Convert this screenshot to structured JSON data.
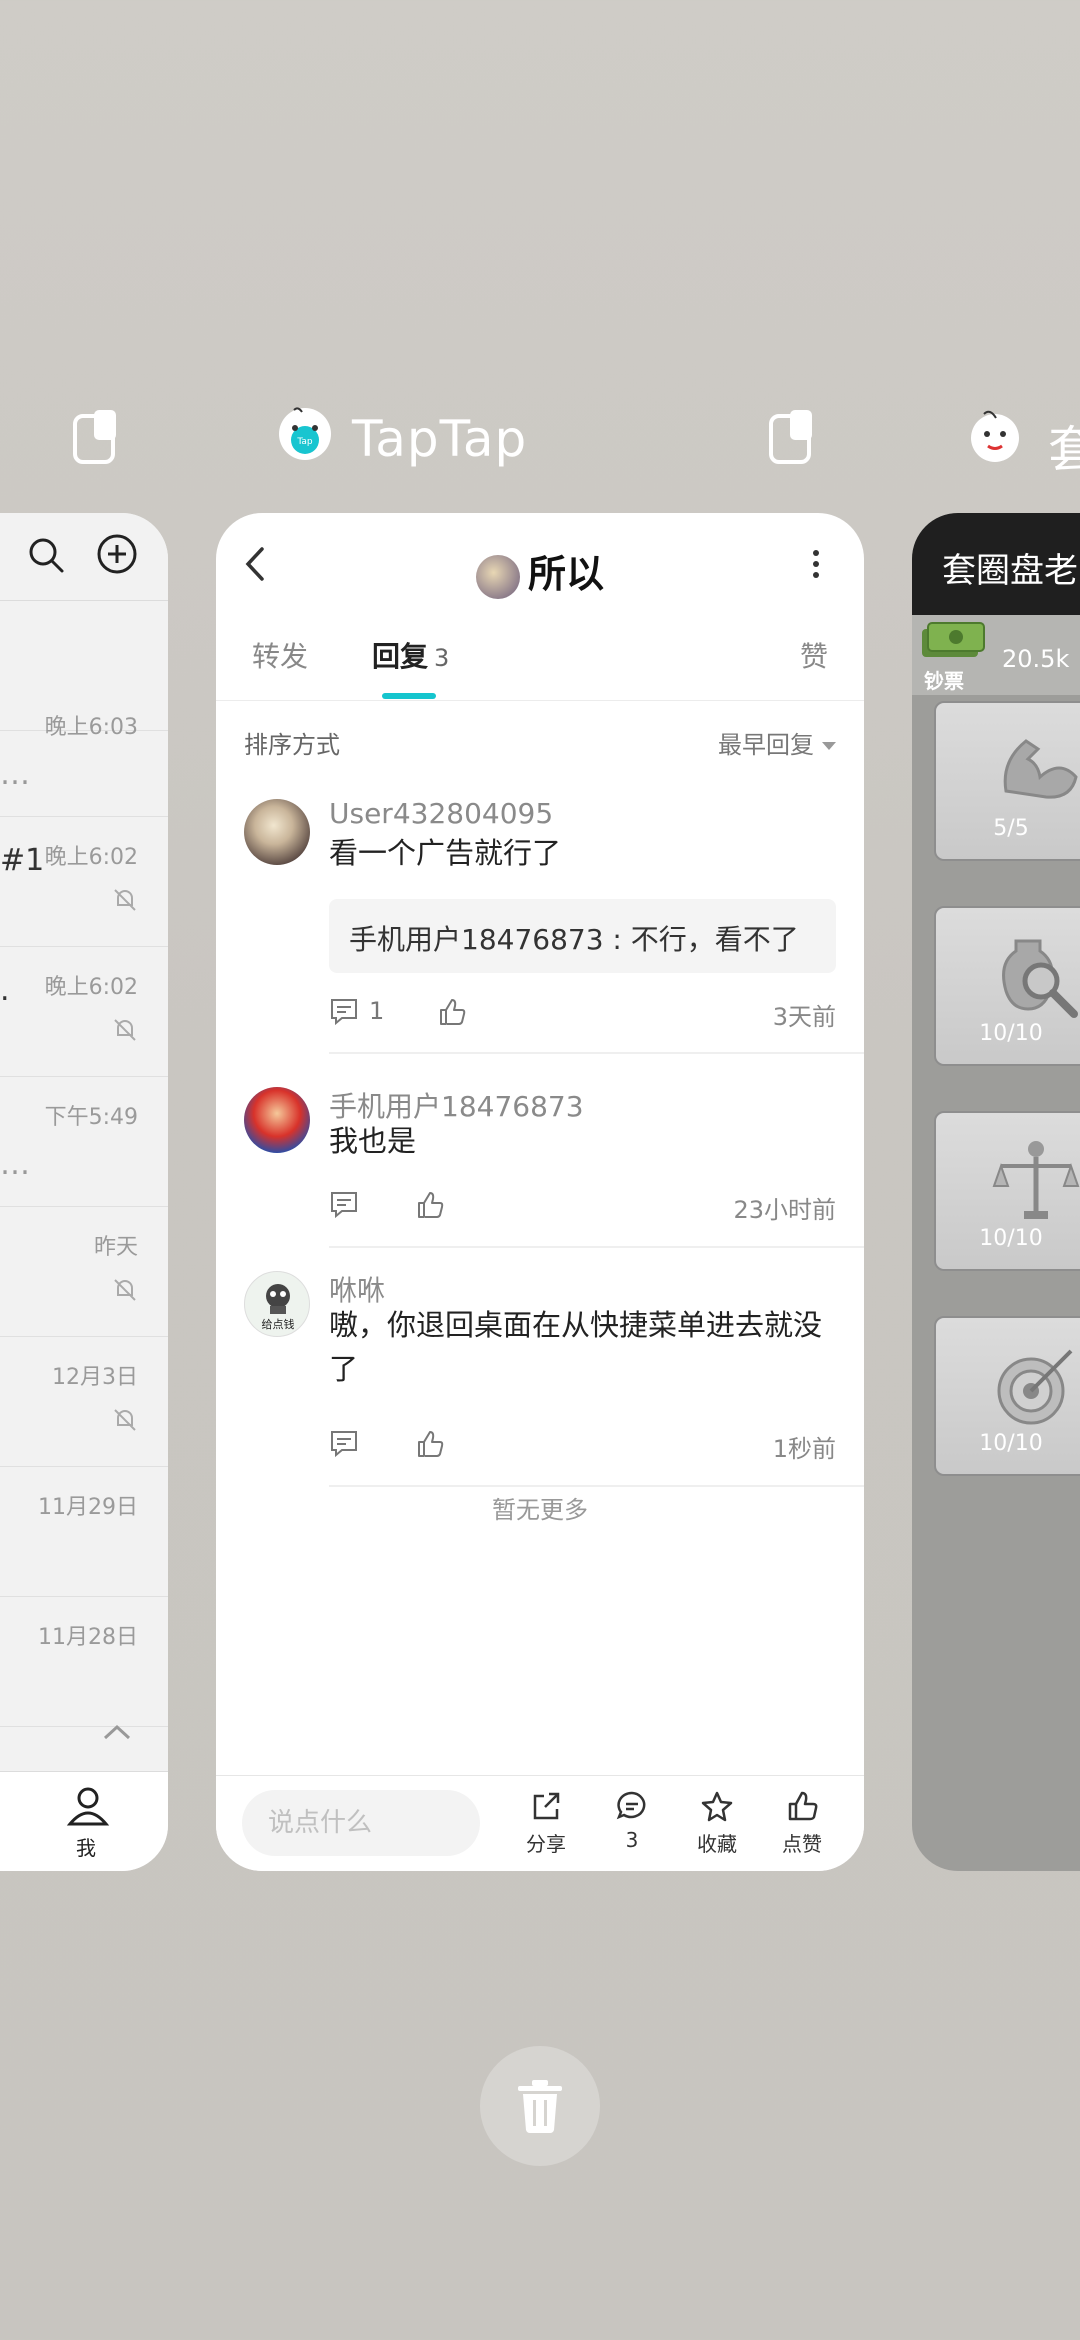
{
  "recents": {
    "center_app_name": "TapTap",
    "right_app_name_partial": "套"
  },
  "left_card": {
    "rows": [
      {
        "time": "晚上6:03",
        "fragment": "…",
        "muted": false
      },
      {
        "time": "晚上6:02",
        "fragment": "#1",
        "muted": true
      },
      {
        "time": "晚上6:02",
        "fragment": ".",
        "muted": true
      },
      {
        "time": "下午5:49",
        "fragment": "…",
        "muted": false
      },
      {
        "time": "昨天",
        "fragment": "",
        "muted": true
      },
      {
        "time": "12月3日",
        "fragment": "",
        "muted": true
      },
      {
        "time": "11月29日",
        "fragment": "",
        "muted": false
      },
      {
        "time": "11月28日",
        "fragment": "",
        "muted": false
      }
    ],
    "bottom_tab_label": "我"
  },
  "taptap": {
    "header_title": "所以",
    "tabs": [
      {
        "label": "转发"
      },
      {
        "label": "回复",
        "count": "3"
      },
      {
        "label": "赞"
      }
    ],
    "sort_label": "排序方式",
    "sort_value": "最早回复",
    "comments": [
      {
        "user": "User432804095",
        "text": "看一个广告就行了",
        "quote": "手机用户18476873 : 不行，看不了",
        "reply_count": "1",
        "time": "3天前"
      },
      {
        "user": "手机用户18476873",
        "text": "我也是",
        "time": "23小时前"
      },
      {
        "user": "咻咻",
        "text": "嗷，你退回桌面在从快捷菜单进去就没了",
        "time": "1秒前",
        "avatar_caption": "给点钱"
      }
    ],
    "no_more": "暂无更多",
    "footer": {
      "input_placeholder": "说点什么",
      "share_label": "分享",
      "comment_count": "3",
      "favorite_label": "收藏",
      "like_label": "点赞"
    },
    "accent_color": "#15c5ce"
  },
  "right_card": {
    "title": "套圈盘老",
    "cash_value": "20.5k",
    "cash_label": "钞票",
    "tiles": [
      {
        "icon": "muscle-icon",
        "value": "5/5"
      },
      {
        "icon": "vase-magnifier-icon",
        "value": "10/10"
      },
      {
        "icon": "scales-icon",
        "value": "10/10"
      },
      {
        "icon": "target-icon",
        "value": "10/10"
      }
    ]
  }
}
